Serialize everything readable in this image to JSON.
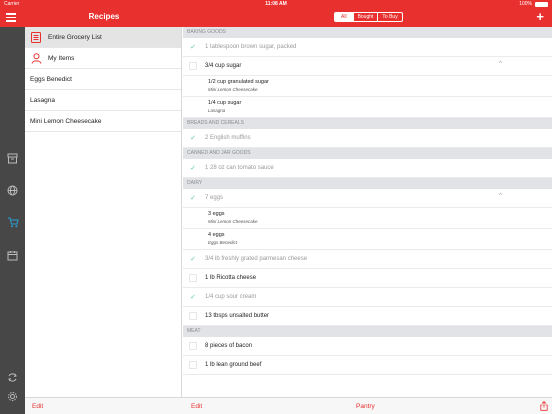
{
  "status": {
    "carrier": "Carrier",
    "time": "11:08 AM",
    "battery": "100%",
    "battery_level": 1.0
  },
  "header": {
    "title": "Recipes",
    "segments": [
      {
        "label": "All",
        "active": true
      },
      {
        "label": "Bought",
        "active": false
      },
      {
        "label": "To Buy",
        "active": false
      }
    ],
    "add_label": "+"
  },
  "colors": {
    "accent": "#e8302f",
    "check": "#59c6b2",
    "rail": "#474747"
  },
  "rail_icons": [
    "menu-icon",
    "archive-icon",
    "globe-icon",
    "cart-icon",
    "calendar-icon",
    "sync-icon",
    "settings-icon"
  ],
  "recipes": [
    {
      "label": "Entire Grocery List",
      "icon": "list-icon",
      "selected": true
    },
    {
      "label": "My Items",
      "icon": "person-icon",
      "selected": false
    },
    {
      "label": "Eggs Benedict"
    },
    {
      "label": "Lasagna"
    },
    {
      "label": "Mini Lemon Cheesecake"
    }
  ],
  "sections": [
    {
      "title": "BAKING GOODS",
      "items": [
        {
          "label": "1 tablespoon brown sugar, packed",
          "checked": true
        },
        {
          "label": "3/4 cup sugar",
          "checked": false,
          "expanded": true,
          "chevron": "^",
          "subs": [
            {
              "q": "1/2 cup granulated sugar",
              "r": "Mini Lemon Cheesecake"
            },
            {
              "q": "1/4 cup sugar",
              "r": "Lasagna"
            }
          ]
        }
      ]
    },
    {
      "title": "BREADS AND CEREALS",
      "items": [
        {
          "label": "2 English muffins",
          "checked": true
        }
      ]
    },
    {
      "title": "CANNED AND JAR GOODS",
      "items": [
        {
          "label": "1 28 oz can tomato sauce",
          "checked": true
        }
      ]
    },
    {
      "title": "DAIRY",
      "items": [
        {
          "label": "7 eggs",
          "checked": true,
          "expanded": true,
          "chevron": "^",
          "subs": [
            {
              "q": "3 eggs",
              "r": "Mini Lemon Cheesecake"
            },
            {
              "q": "4 eggs",
              "r": "Eggs Benedict"
            }
          ]
        },
        {
          "label": "3/4 lb freshly grated parmesan cheese",
          "checked": true
        },
        {
          "label": "1 lb Ricotta cheese",
          "checked": false
        },
        {
          "label": "1/4 cup sour cream",
          "checked": true
        },
        {
          "label": "13 tbsps unsalted butter",
          "checked": false
        }
      ]
    },
    {
      "title": "MEAT",
      "items": [
        {
          "label": "8 pieces of bacon",
          "checked": false
        },
        {
          "label": "1 lb lean ground beef",
          "checked": false
        }
      ]
    }
  ],
  "bottom": {
    "edit_left": "Edit",
    "edit_right": "Edit",
    "pantry": "Pantry"
  }
}
